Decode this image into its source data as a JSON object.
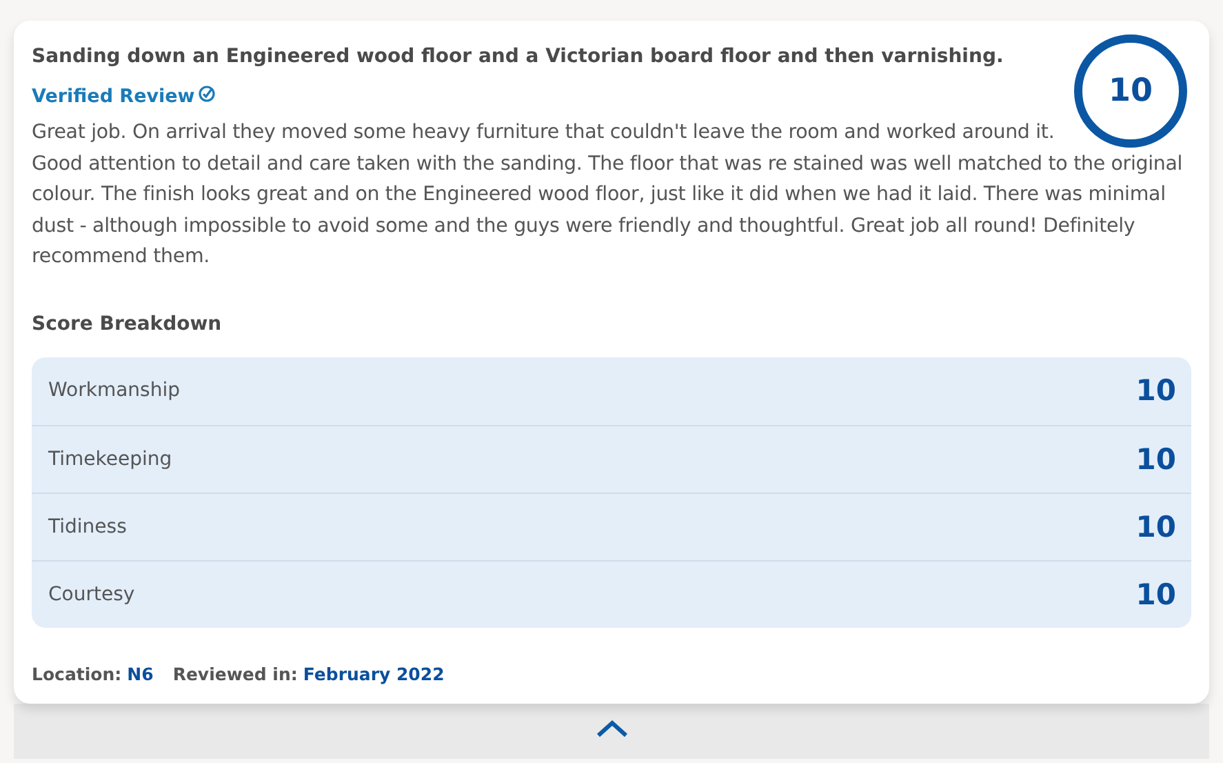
{
  "review": {
    "title": "Sanding down an Engineered wood floor and a Victorian board floor and then varnishing.",
    "verified_label": "Verified Review",
    "overall_score": "10",
    "body": "Great job. On arrival they moved some heavy furniture that couldn't leave the room and worked around it. Good attention to detail and care taken with the sanding. The floor that was re stained was well matched to the original colour. The finish looks great and on the Engineered wood floor, just like it did when we had it laid. There was minimal dust - although impossible to avoid some and the guys were friendly and thoughtful. Great job all round! Definitely recommend them.",
    "breakdown_heading": "Score Breakdown",
    "breakdown": [
      {
        "label": "Workmanship",
        "score": "10"
      },
      {
        "label": "Timekeeping",
        "score": "10"
      },
      {
        "label": "Tidiness",
        "score": "10"
      },
      {
        "label": "Courtesy",
        "score": "10"
      }
    ],
    "location_label": "Location:",
    "location": "N6",
    "reviewed_label": "Reviewed in:",
    "reviewed": "February 2022"
  }
}
